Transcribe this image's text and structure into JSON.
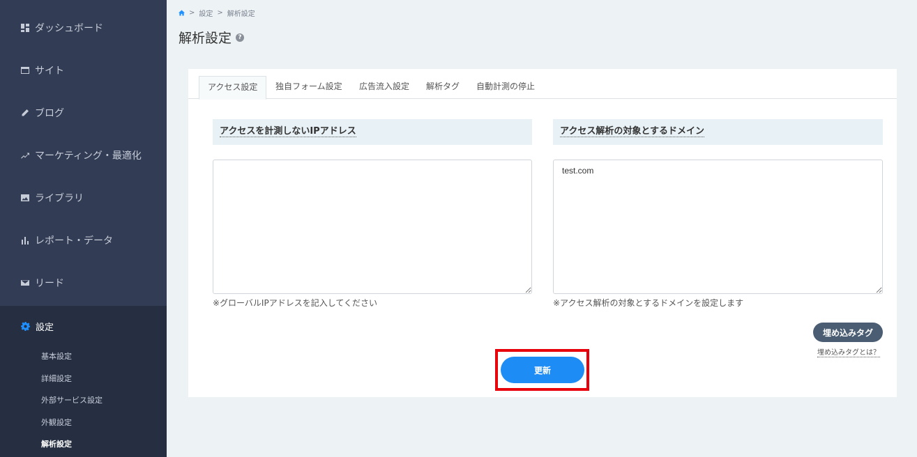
{
  "sidebar": {
    "items": [
      {
        "label": "ダッシュボード",
        "icon": "dashboard-icon"
      },
      {
        "label": "サイト",
        "icon": "window-icon"
      },
      {
        "label": "ブログ",
        "icon": "pencil-icon"
      },
      {
        "label": "マーケティング・最適化",
        "icon": "trend-icon"
      },
      {
        "label": "ライブラリ",
        "icon": "image-icon"
      },
      {
        "label": "レポート・データ",
        "icon": "bar-chart-icon"
      },
      {
        "label": "リード",
        "icon": "mail-icon"
      }
    ],
    "settings": {
      "label": "設定",
      "icon": "gear-icon",
      "sub_items": [
        "基本設定",
        "詳細設定",
        "外部サービス設定",
        "外観設定",
        "解析設定"
      ],
      "active_sub_item": "解析設定"
    }
  },
  "breadcrumb": {
    "separator": ">",
    "items": [
      "設定",
      "解析設定"
    ]
  },
  "page": {
    "title": "解析設定"
  },
  "tabs": [
    "アクセス設定",
    "独自フォーム設定",
    "広告流入設定",
    "解析タグ",
    "自動計測の停止"
  ],
  "active_tab": "アクセス設定",
  "ip_section": {
    "title": "アクセスを計測しないIPアドレス",
    "value": "",
    "hint": "※グローバルIPアドレスを記入してください"
  },
  "domain_section": {
    "title": "アクセス解析の対象とするドメイン",
    "value": "test.com",
    "hint": "※アクセス解析の対象とするドメインを設定します"
  },
  "embed": {
    "button_label": "埋め込みタグ",
    "link_label": "埋め込みタグとは？"
  },
  "update_button": {
    "label": "更新"
  },
  "colors": {
    "sidebar_bg": "#323d55",
    "accent": "#1e8cf5",
    "highlight": "#e8000b"
  }
}
